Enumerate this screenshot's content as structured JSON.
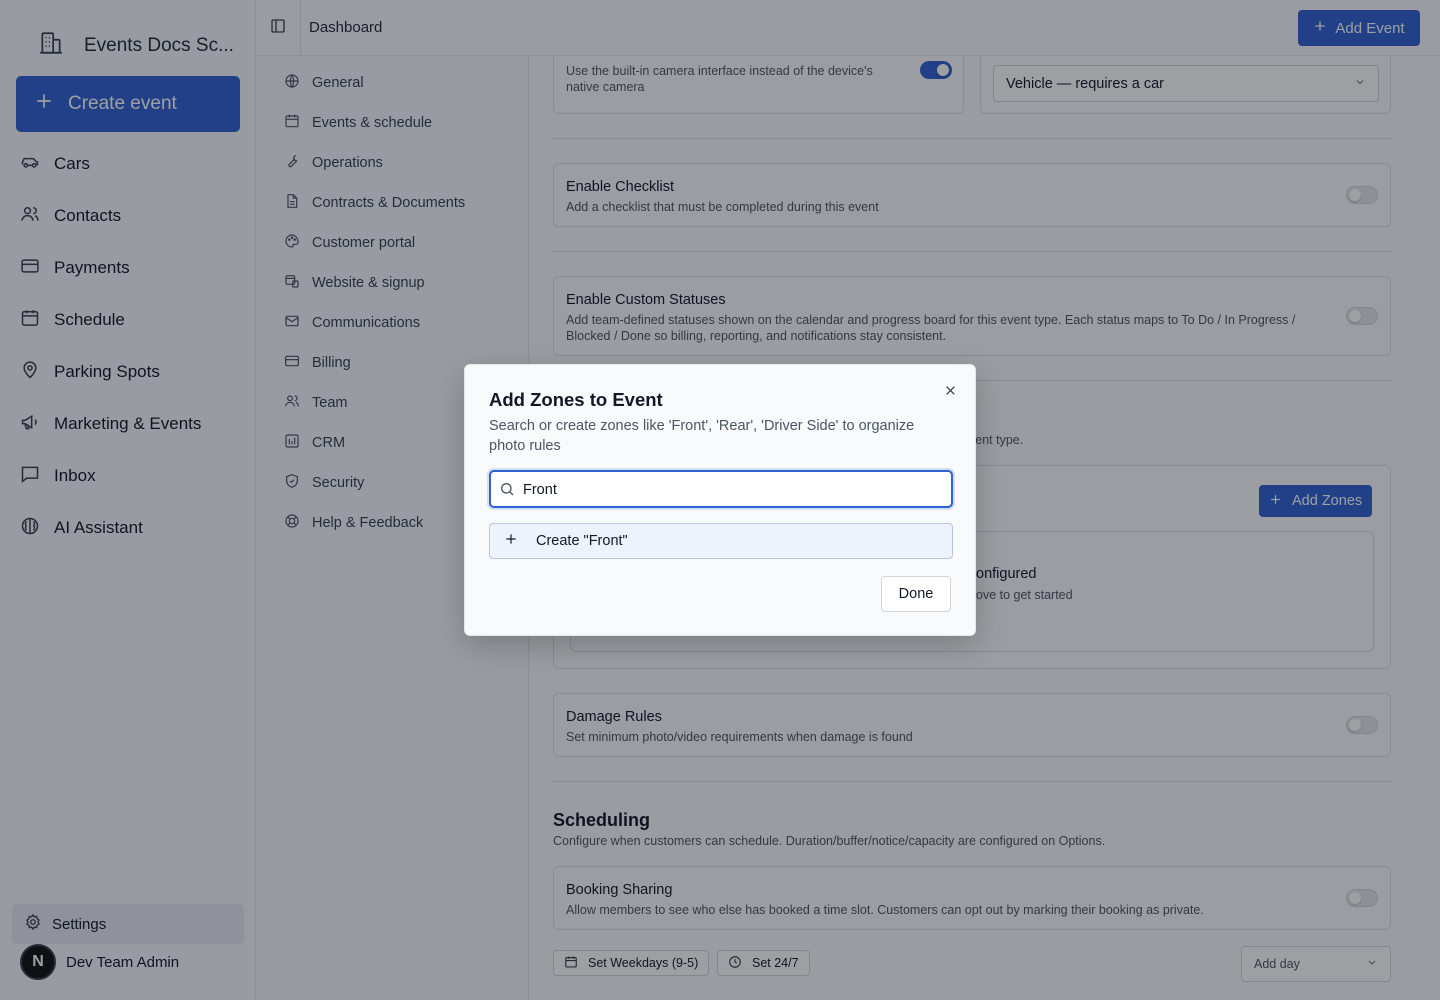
{
  "app": {
    "brand_title": "Events Docs Sc...",
    "create_event_label": "Create event",
    "nav": [
      {
        "label": "Cars",
        "icon": "car-icon"
      },
      {
        "label": "Contacts",
        "icon": "users-icon"
      },
      {
        "label": "Payments",
        "icon": "credit-card-icon"
      },
      {
        "label": "Schedule",
        "icon": "calendar-icon"
      },
      {
        "label": "Parking Spots",
        "icon": "map-pin-icon"
      },
      {
        "label": "Marketing & Events",
        "icon": "megaphone-icon"
      },
      {
        "label": "Inbox",
        "icon": "message-icon"
      },
      {
        "label": "AI Assistant",
        "icon": "brain-icon"
      }
    ],
    "settings_label": "Settings",
    "user_name": "Dev Team Admin",
    "avatar_letter": "N"
  },
  "topbar": {
    "breadcrumb": "Dashboard",
    "add_event_label": "Add Event"
  },
  "subnav": [
    {
      "label": "General",
      "icon": "globe-icon"
    },
    {
      "label": "Events & schedule",
      "icon": "calendar-icon"
    },
    {
      "label": "Operations",
      "icon": "wrench-icon"
    },
    {
      "label": "Contracts & Documents",
      "icon": "file-icon"
    },
    {
      "label": "Customer portal",
      "icon": "palette-icon"
    },
    {
      "label": "Website & signup",
      "icon": "web-icon"
    },
    {
      "label": "Communications",
      "icon": "mail-icon"
    },
    {
      "label": "Billing",
      "icon": "credit-card-icon"
    },
    {
      "label": "Team",
      "icon": "users-icon"
    },
    {
      "label": "CRM",
      "icon": "crm-icon"
    },
    {
      "label": "Security",
      "icon": "shield-icon"
    },
    {
      "label": "Help & Feedback",
      "icon": "lifebuoy-icon"
    }
  ],
  "main": {
    "camera_desc": "Use the built-in camera interface instead of the device's native camera",
    "vehicle_select": "Vehicle — requires a car",
    "checklist": {
      "title": "Enable Checklist",
      "desc": "Add a checklist that must be completed during this event"
    },
    "custom_statuses": {
      "title": "Enable Custom Statuses",
      "desc": "Add team-defined statuses shown on the calendar and progress board for this event type. Each status maps to To Do / In Progress / Blocked / Done so billing, reporting, and notifications stay consistent."
    },
    "zones_desc_tail": "vent type.",
    "add_zones_label": "Add Zones",
    "empty_title_tail": "onfigured",
    "empty_desc_tail": "ove to get started",
    "damage": {
      "title": "Damage Rules",
      "desc": "Set minimum photo/video requirements when damage is found"
    },
    "scheduling": {
      "title": "Scheduling",
      "desc": "Configure when customers can schedule. Duration/buffer/notice/capacity are configured on Options."
    },
    "booking": {
      "title": "Booking Sharing",
      "desc": "Allow members to see who else has booked a time slot. Customers can opt out by marking their booking as private."
    },
    "weekdays_label": "Set Weekdays (9-5)",
    "all_week_label": "Set 24/7",
    "add_day_label": "Add day"
  },
  "modal": {
    "title": "Add Zones to Event",
    "desc": "Search or create zones like 'Front', 'Rear', 'Driver Side' to organize photo rules",
    "search_value": "Front",
    "create_option": "Create \"Front\"",
    "done_label": "Done"
  },
  "colors": {
    "accent": "#2f62d1"
  }
}
